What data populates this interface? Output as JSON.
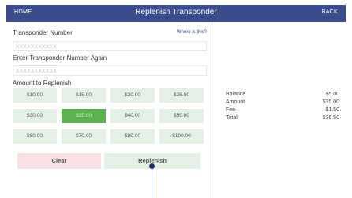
{
  "header": {
    "home_label": "HOME",
    "title": "Replenish Transponder",
    "back_label": "BACK"
  },
  "form": {
    "transponder_label": "Transponder Number",
    "where_link": "Where is this?",
    "transponder_placeholder": "XXXXXXXXXXX",
    "confirm_label": "Enter Transponder Number Again",
    "confirm_placeholder": "XXXXXXXXXXX",
    "amount_label": "Amount to Replenish",
    "amounts": [
      {
        "label": "$10.00",
        "selected": false
      },
      {
        "label": "$15.00",
        "selected": false
      },
      {
        "label": "$20.00",
        "selected": false
      },
      {
        "label": "$25.00",
        "selected": false
      },
      {
        "label": "$30.00",
        "selected": false
      },
      {
        "label": "$35.00",
        "selected": true
      },
      {
        "label": "$40.00",
        "selected": false
      },
      {
        "label": "$50.00",
        "selected": false
      },
      {
        "label": "$60.00",
        "selected": false
      },
      {
        "label": "$70.00",
        "selected": false
      },
      {
        "label": "$80.00",
        "selected": false
      },
      {
        "label": "$100.00",
        "selected": false
      }
    ],
    "clear_label": "Clear",
    "replenish_label": "Replenish"
  },
  "summary": {
    "rows": [
      {
        "label": "Balance",
        "value": "$5.00"
      },
      {
        "label": "Amount",
        "value": "$35.00"
      },
      {
        "label": "Fee",
        "value": "$1.50"
      },
      {
        "label": "Total",
        "value": "$36.50"
      }
    ]
  },
  "colors": {
    "header_bg": "#3b4d8e",
    "amount_bg": "#e4efe6",
    "amount_selected_bg": "#5eb052",
    "clear_bg": "#f8dfe3"
  }
}
